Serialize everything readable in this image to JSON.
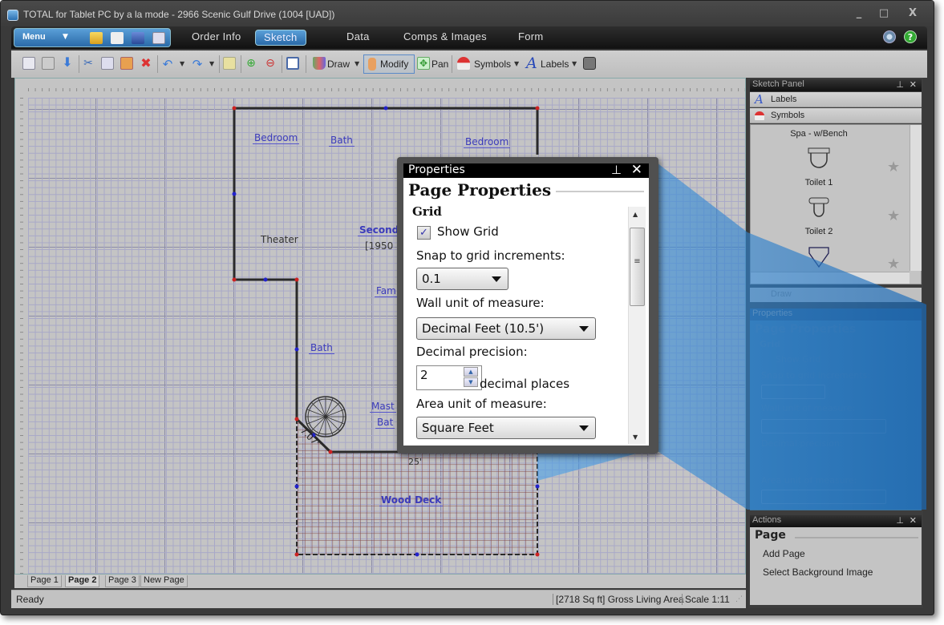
{
  "window": {
    "title": "TOTAL for Tablet PC by a la mode - 2966 Scenic Gulf Drive (1004 [UAD])",
    "controls": {
      "minimize": "_",
      "maximize": "□",
      "close": "X"
    }
  },
  "menubar": {
    "menu_label": "Menu",
    "tabs": [
      {
        "label": "Order Info",
        "active": false
      },
      {
        "label": "Sketch",
        "active": true
      },
      {
        "label": "Data",
        "active": false
      },
      {
        "label": "Comps & Images",
        "active": false
      },
      {
        "label": "Form",
        "active": false
      }
    ],
    "help_glyph": "?"
  },
  "toolbar": {
    "draw_label": "Draw",
    "modify_label": "Modify",
    "pan_label": "Pan",
    "symbols_label": "Symbols",
    "labels_label": "Labels"
  },
  "sketch": {
    "rooms": [
      {
        "label": "Bedroom",
        "style": "label"
      },
      {
        "label": "Bath",
        "style": "label"
      },
      {
        "label": "Bedroom",
        "style": "label"
      },
      {
        "label": "Theater",
        "style": "plain"
      },
      {
        "label": "Second",
        "style": "bold"
      },
      {
        "label": "[1950",
        "style": "plain"
      },
      {
        "label": "Fam",
        "style": "label"
      },
      {
        "label": "Bath",
        "style": "label"
      },
      {
        "label": "Mast",
        "style": "label"
      },
      {
        "label": "Bat",
        "style": "label"
      },
      {
        "label": "Wood Deck",
        "style": "bold"
      }
    ],
    "dimensions": {
      "diagonal": "7.07'",
      "bottom_wall": "25'"
    },
    "colors": {
      "wall": "#2a2a2a",
      "vertex": "#cc2222",
      "midpoint": "#2222cc",
      "deck_grid": "#7a3a3a",
      "label": "#3b3bbb"
    }
  },
  "page_tabs": [
    {
      "label": "Page 1",
      "active": false
    },
    {
      "label": "Page 2",
      "active": true
    },
    {
      "label": "Page 3",
      "active": false
    },
    {
      "label": "New Page",
      "active": false
    }
  ],
  "statusbar": {
    "status": "Ready",
    "gla": "[2718 Sq ft] Gross Living Area",
    "scale": "Scale 1:11"
  },
  "sketch_panel": {
    "title": "Sketch Panel",
    "sections": [
      {
        "label": "Labels"
      },
      {
        "label": "Symbols"
      }
    ],
    "symbols": [
      {
        "label": "Spa - w/Bench"
      },
      {
        "label": "Toilet 1"
      },
      {
        "label": "Toilet 2"
      }
    ],
    "draw_label": "Draw"
  },
  "properties": {
    "header": "Properties",
    "title": "Page Properties",
    "section": "Grid",
    "show_grid_label": "Show Grid",
    "show_grid_checked": true,
    "snap_label": "Snap to grid increments:",
    "snap_value": "0.1",
    "wall_unit_label": "Wall unit of measure:",
    "wall_unit_value": "Decimal Feet (10.5')",
    "precision_label": "Decimal precision:",
    "precision_value": "2",
    "precision_suffix": "decimal places",
    "area_unit_label": "Area unit of measure:",
    "area_unit_value": "Square Feet"
  },
  "actions": {
    "header": "Actions",
    "title": "Page",
    "items": [
      {
        "label": "Add Page"
      },
      {
        "label": "Select Background Image"
      }
    ]
  },
  "icons": {
    "pin": "⊥",
    "close": "✕",
    "star": "★",
    "check": "✓"
  }
}
